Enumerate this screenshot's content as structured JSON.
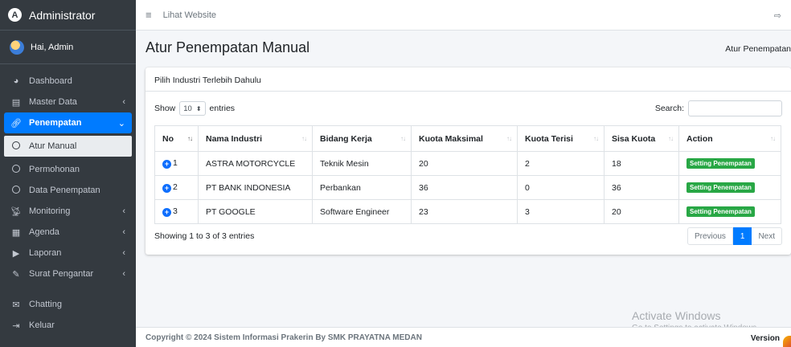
{
  "brand": {
    "title": "Administrator",
    "logo": "A"
  },
  "user": {
    "greeting": "Hai, Admin"
  },
  "sidebar": {
    "items": [
      {
        "label": "Dashboard",
        "icon": "dashboard-icon"
      },
      {
        "label": "Master Data",
        "icon": "book-icon",
        "arrow": "‹"
      },
      {
        "label": "Penempatan",
        "icon": "link-icon",
        "arrow": "⌄"
      },
      {
        "label": "Atur Manual",
        "icon": "circle-icon"
      },
      {
        "label": "Permohonan",
        "icon": "circle-icon"
      },
      {
        "label": "Data Penempatan",
        "icon": "circle-icon"
      },
      {
        "label": "Monitoring",
        "icon": "satellite-icon",
        "arrow": "‹"
      },
      {
        "label": "Agenda",
        "icon": "calendar-icon",
        "arrow": "‹"
      },
      {
        "label": "Laporan",
        "icon": "file-export-icon",
        "arrow": "‹"
      },
      {
        "label": "Surat Pengantar",
        "icon": "signature-icon",
        "arrow": "‹"
      },
      {
        "label": "Chatting",
        "icon": "envelope-icon"
      },
      {
        "label": "Keluar",
        "icon": "sign-out-icon"
      }
    ]
  },
  "topbar": {
    "link": "Lihat Website"
  },
  "header": {
    "title": "Atur Penempatan Manual",
    "breadcrumb": "Atur Penempatan"
  },
  "card": {
    "header": "Pilih Industri Terlebih Dahulu",
    "show_label": "Show",
    "length_value": "10",
    "entries_label": "entries",
    "search_label": "Search:",
    "search_value": ""
  },
  "table": {
    "columns": [
      "No",
      "Nama Industri",
      "Bidang Kerja",
      "Kuota Maksimal",
      "Kuota Terisi",
      "Sisa Kuota",
      "Action"
    ],
    "rows": [
      {
        "no": "1",
        "industri": "ASTRA MOTORCYCLE",
        "bidang": "Teknik Mesin",
        "maks": "20",
        "terisi": "2",
        "sisa": "18",
        "action": "Setting Penempatan"
      },
      {
        "no": "2",
        "industri": "PT BANK INDONESIA",
        "bidang": "Perbankan",
        "maks": "36",
        "terisi": "0",
        "sisa": "36",
        "action": "Setting Penempatan"
      },
      {
        "no": "3",
        "industri": "PT GOOGLE",
        "bidang": "Software Engineer",
        "maks": "23",
        "terisi": "3",
        "sisa": "20",
        "action": "Setting Penempatan"
      }
    ]
  },
  "info": "Showing 1 to 3 of 3 entries",
  "pager": {
    "prev": "Previous",
    "page": "1",
    "next": "Next"
  },
  "footer": {
    "copyright": "Copyright © 2024 Sistem Informasi Prakerin By SMK PRAYATNA MEDAN",
    "version": "Version"
  },
  "watermark": {
    "line1": "Activate Windows",
    "line2": "Go to Settings to activate Windows."
  },
  "colors": {
    "sidebar": "#343a40",
    "accent": "#007bff",
    "badge": "#28a745"
  }
}
